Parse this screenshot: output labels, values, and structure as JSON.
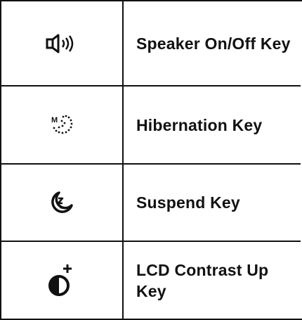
{
  "rows": [
    {
      "icon": "speaker-icon",
      "label": "Speaker On/Off Key"
    },
    {
      "icon": "hibernation-icon",
      "label": "Hibernation Key"
    },
    {
      "icon": "suspend-icon",
      "label": "Suspend Key"
    },
    {
      "icon": "lcd-contrast-up-icon",
      "label": "LCD Contrast Up Key"
    }
  ],
  "hibernation_icon_text": "M"
}
